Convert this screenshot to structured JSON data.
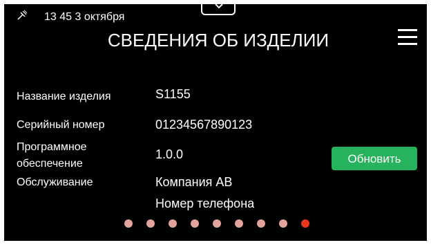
{
  "status_bar": {
    "icon": "satellite-signal-icon",
    "time_date": "13 45 3 октября"
  },
  "header": {
    "title": "СВЕДЕНИЯ ОБ ИЗДЕЛИИ",
    "menu_icon": "hamburger-menu-icon",
    "pull_tab_icon": "chevron-down-icon"
  },
  "info": {
    "product_name_label": "Название изделия",
    "product_name_value": "S1155",
    "serial_label": "Серийный номер",
    "serial_value": "01234567890123",
    "software_label_line1": "Программное",
    "software_label_line2": "обеспечение",
    "software_value": "1.0.0",
    "service_label": "Обслуживание",
    "service_company": "Компания АВ",
    "service_phone": "Номер телефона"
  },
  "update_button": {
    "label": "Обновить",
    "color": "#27b35d"
  },
  "pagination": {
    "total_pages": 9,
    "active_page": 9,
    "dot_color": "#e2a39a",
    "active_color": "#e8351f"
  }
}
